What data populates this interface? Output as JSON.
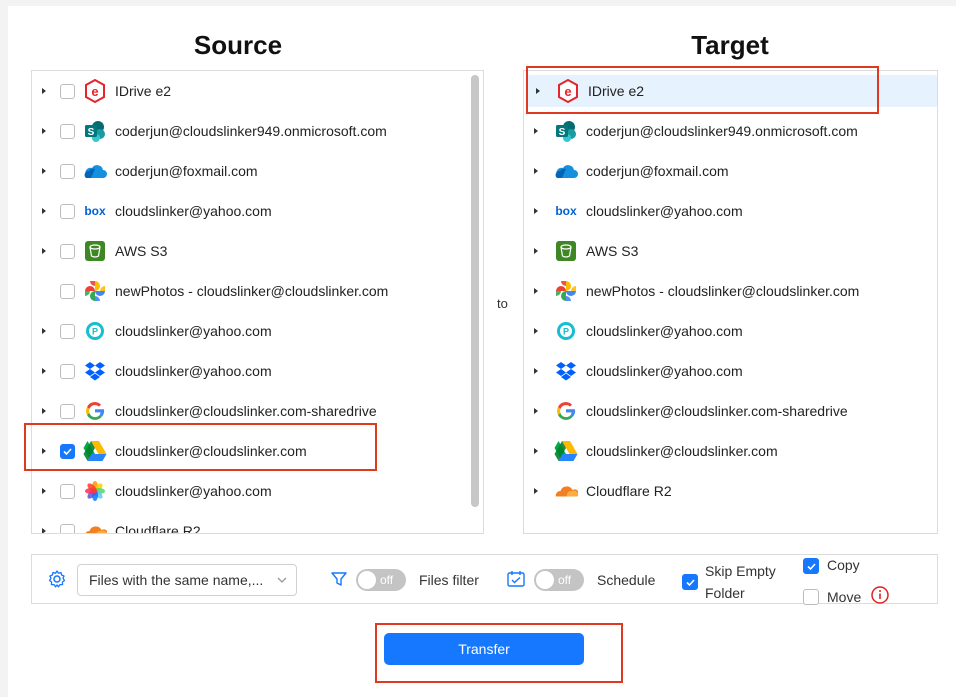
{
  "headings": {
    "source": "Source",
    "target": "Target"
  },
  "to_label": "to",
  "source_items": [
    {
      "label": "IDrive e2",
      "icon": "idrive-e2-icon",
      "expandable": true,
      "checked": false
    },
    {
      "label": "coderjun@cloudslinker949.onmicrosoft.com",
      "icon": "sharepoint-icon",
      "expandable": true,
      "checked": false
    },
    {
      "label": "coderjun@foxmail.com",
      "icon": "onedrive-icon",
      "expandable": true,
      "checked": false
    },
    {
      "label": "cloudslinker@yahoo.com",
      "icon": "box-icon",
      "expandable": true,
      "checked": false
    },
    {
      "label": "AWS S3",
      "icon": "aws-s3-icon",
      "expandable": true,
      "checked": false
    },
    {
      "label": "newPhotos - cloudslinker@cloudslinker.com",
      "icon": "google-photos-icon",
      "expandable": false,
      "checked": false
    },
    {
      "label": "cloudslinker@yahoo.com",
      "icon": "pcloud-icon",
      "expandable": true,
      "checked": false
    },
    {
      "label": "cloudslinker@yahoo.com",
      "icon": "dropbox-icon",
      "expandable": true,
      "checked": false
    },
    {
      "label": "cloudslinker@cloudslinker.com-sharedrive",
      "icon": "google-icon",
      "expandable": true,
      "checked": false
    },
    {
      "label": "cloudslinker@cloudslinker.com",
      "icon": "google-drive-icon",
      "expandable": true,
      "checked": true
    },
    {
      "label": "cloudslinker@yahoo.com",
      "icon": "icloud-photos-icon",
      "expandable": true,
      "checked": false
    },
    {
      "label": "Cloudflare R2",
      "icon": "cloudflare-icon",
      "expandable": true,
      "checked": false
    }
  ],
  "target_items": [
    {
      "label": "IDrive e2",
      "icon": "idrive-e2-icon",
      "selected": true
    },
    {
      "label": "coderjun@cloudslinker949.onmicrosoft.com",
      "icon": "sharepoint-icon",
      "selected": false
    },
    {
      "label": "coderjun@foxmail.com",
      "icon": "onedrive-icon",
      "selected": false
    },
    {
      "label": "cloudslinker@yahoo.com",
      "icon": "box-icon",
      "selected": false
    },
    {
      "label": "AWS S3",
      "icon": "aws-s3-icon",
      "selected": false
    },
    {
      "label": "newPhotos - cloudslinker@cloudslinker.com",
      "icon": "google-photos-icon",
      "selected": false
    },
    {
      "label": "cloudslinker@yahoo.com",
      "icon": "pcloud-icon",
      "selected": false
    },
    {
      "label": "cloudslinker@yahoo.com",
      "icon": "dropbox-icon",
      "selected": false
    },
    {
      "label": "cloudslinker@cloudslinker.com-sharedrive",
      "icon": "google-icon",
      "selected": false
    },
    {
      "label": "cloudslinker@cloudslinker.com",
      "icon": "google-drive-icon",
      "selected": false
    },
    {
      "label": "Cloudflare R2",
      "icon": "cloudflare-icon",
      "selected": false
    }
  ],
  "options": {
    "conflict_select_value": "Files with the same name,...",
    "files_filter_toggle": "off",
    "files_filter_label": "Files filter",
    "schedule_toggle": "off",
    "schedule_label": "Schedule",
    "skip_empty_folder_line1": "Skip Empty",
    "skip_empty_folder_line2": "Folder",
    "skip_empty_folder_checked": true,
    "copy_label": "Copy",
    "copy_checked": true,
    "move_label": "Move",
    "move_checked": false
  },
  "transfer_button": "Transfer",
  "colors": {
    "accent": "#1677ff",
    "highlight": "#e0391f",
    "selected_row": "#e6f2fd"
  }
}
